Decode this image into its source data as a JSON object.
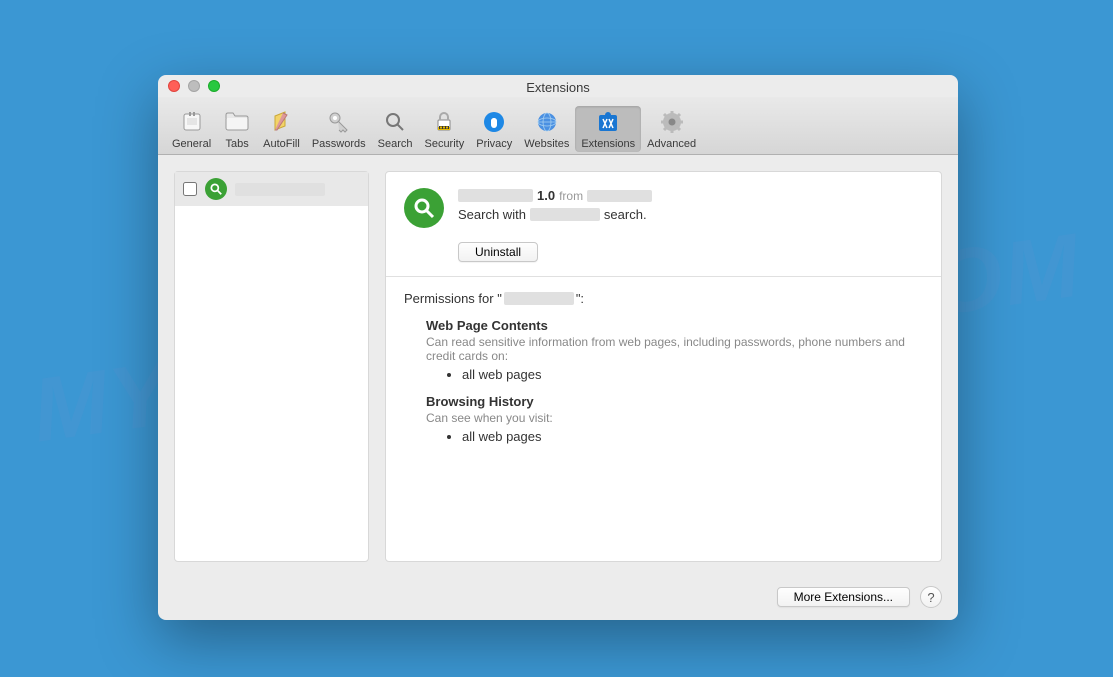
{
  "watermark": "MYANTISPYWARE.COM",
  "window": {
    "title": "Extensions"
  },
  "toolbar": {
    "items": [
      {
        "label": "General",
        "icon": "general"
      },
      {
        "label": "Tabs",
        "icon": "tabs"
      },
      {
        "label": "AutoFill",
        "icon": "autofill"
      },
      {
        "label": "Passwords",
        "icon": "passwords"
      },
      {
        "label": "Search",
        "icon": "search"
      },
      {
        "label": "Security",
        "icon": "security"
      },
      {
        "label": "Privacy",
        "icon": "privacy"
      },
      {
        "label": "Websites",
        "icon": "websites"
      },
      {
        "label": "Extensions",
        "icon": "extensions"
      },
      {
        "label": "Advanced",
        "icon": "advanced"
      }
    ],
    "active_index": 8
  },
  "extension": {
    "version": "1.0",
    "from_label": "from",
    "description_prefix": "Search with",
    "description_suffix": "search.",
    "uninstall_label": "Uninstall"
  },
  "permissions": {
    "title_prefix": "Permissions for \"",
    "title_suffix": "\":",
    "blocks": [
      {
        "heading": "Web Page Contents",
        "desc": "Can read sensitive information from web pages, including passwords, phone numbers and credit cards on:",
        "items": [
          "all web pages"
        ]
      },
      {
        "heading": "Browsing History",
        "desc": "Can see when you visit:",
        "items": [
          "all web pages"
        ]
      }
    ]
  },
  "footer": {
    "more_extensions": "More Extensions...",
    "help": "?"
  }
}
